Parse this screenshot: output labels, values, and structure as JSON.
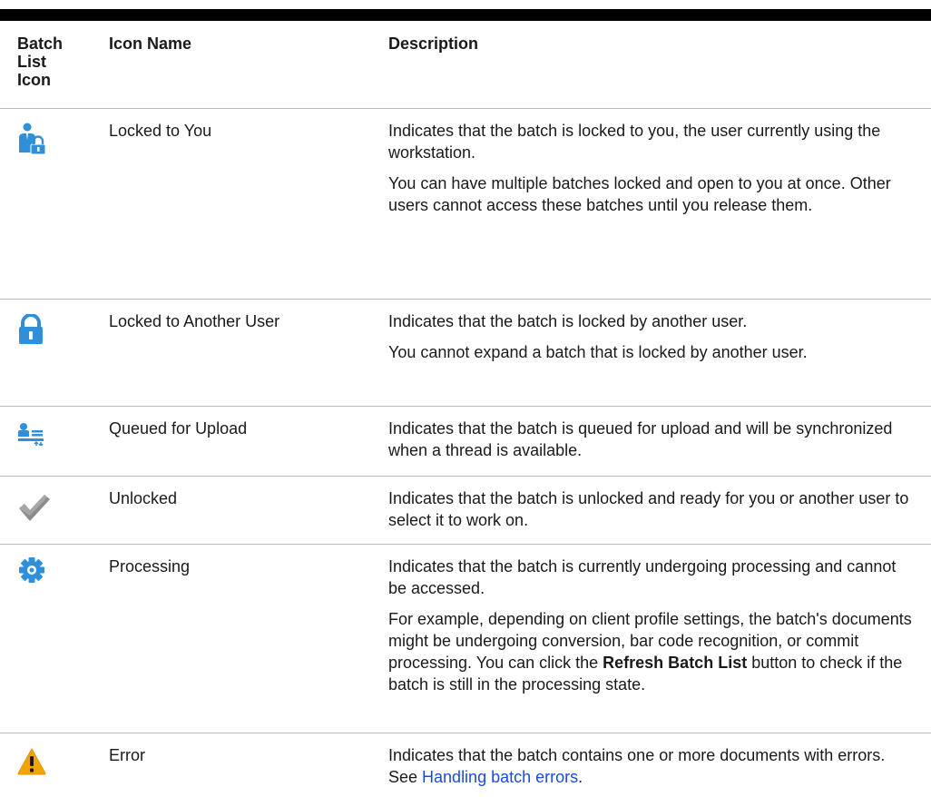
{
  "table": {
    "headers": {
      "icon_col": "Batch List Icon",
      "icon_col_lines": [
        "Batch",
        "List",
        "Icon"
      ],
      "name_col": "Icon Name",
      "desc_col": "Description"
    },
    "rows": [
      {
        "icon": "user-lock-icon",
        "name": "Locked to You",
        "paragraphs": [
          "Indicates that the batch is locked to you, the user currently using the workstation.",
          "You can have multiple batches locked and open to you at once. Other users cannot access these batches until you release them."
        ]
      },
      {
        "icon": "lock-icon",
        "name": "Locked to Another User",
        "paragraphs": [
          "Indicates that the batch is locked by another user.",
          "You cannot expand a batch that is locked by another user."
        ]
      },
      {
        "icon": "queue-upload-icon",
        "name": "Queued for Upload",
        "paragraphs": [
          "Indicates that the batch is queued for upload and will be synchronized when a thread is available."
        ]
      },
      {
        "icon": "checkmark-icon",
        "name": "Unlocked",
        "paragraphs": [
          "Indicates that the batch is unlocked and ready for you or another user to select it to work on."
        ]
      },
      {
        "icon": "gear-icon",
        "name": "Processing",
        "paragraphs": [
          "Indicates that the batch is currently undergoing processing and cannot be accessed."
        ],
        "example": {
          "before": "For example, depending on client profile settings, the batch's documents might be undergoing conversion, bar code recognition, or commit processing. You can click the ",
          "bold": "Refresh Batch List",
          "after": " button to check if the batch is still in the processing state."
        }
      },
      {
        "icon": "warning-icon",
        "name": "Error",
        "paragraphs": [],
        "desc_before": "Indicates that the batch contains one or more documents with errors. See ",
        "link": "Handling batch errors",
        "desc_after": "."
      }
    ]
  },
  "colors": {
    "icon_blue": "#2f8fd8",
    "icon_gray": "#8c8c8c",
    "warning_orange": "#f0a500",
    "link": "#1c4ae8"
  }
}
